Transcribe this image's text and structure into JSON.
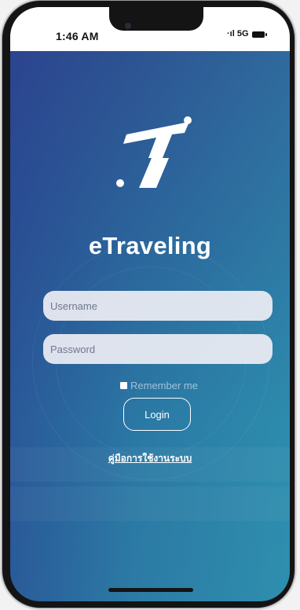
{
  "status_bar": {
    "time": "1:46 AM",
    "signal": "·ıl 5G",
    "battery_icon": "battery-icon"
  },
  "app": {
    "logo_icon": "etraveling-logo-icon",
    "title": "eTraveling"
  },
  "login_form": {
    "username_placeholder": "Username",
    "password_placeholder": "Password",
    "remember_label": "Remember me",
    "login_label": "Login",
    "manual_link": "คู่มือการใช้งานระบบ"
  },
  "colors": {
    "gradient_top": "#2f4f8f",
    "gradient_bottom": "#2b86a8",
    "text": "#ffffff",
    "field_bg": "#eeeef4"
  }
}
